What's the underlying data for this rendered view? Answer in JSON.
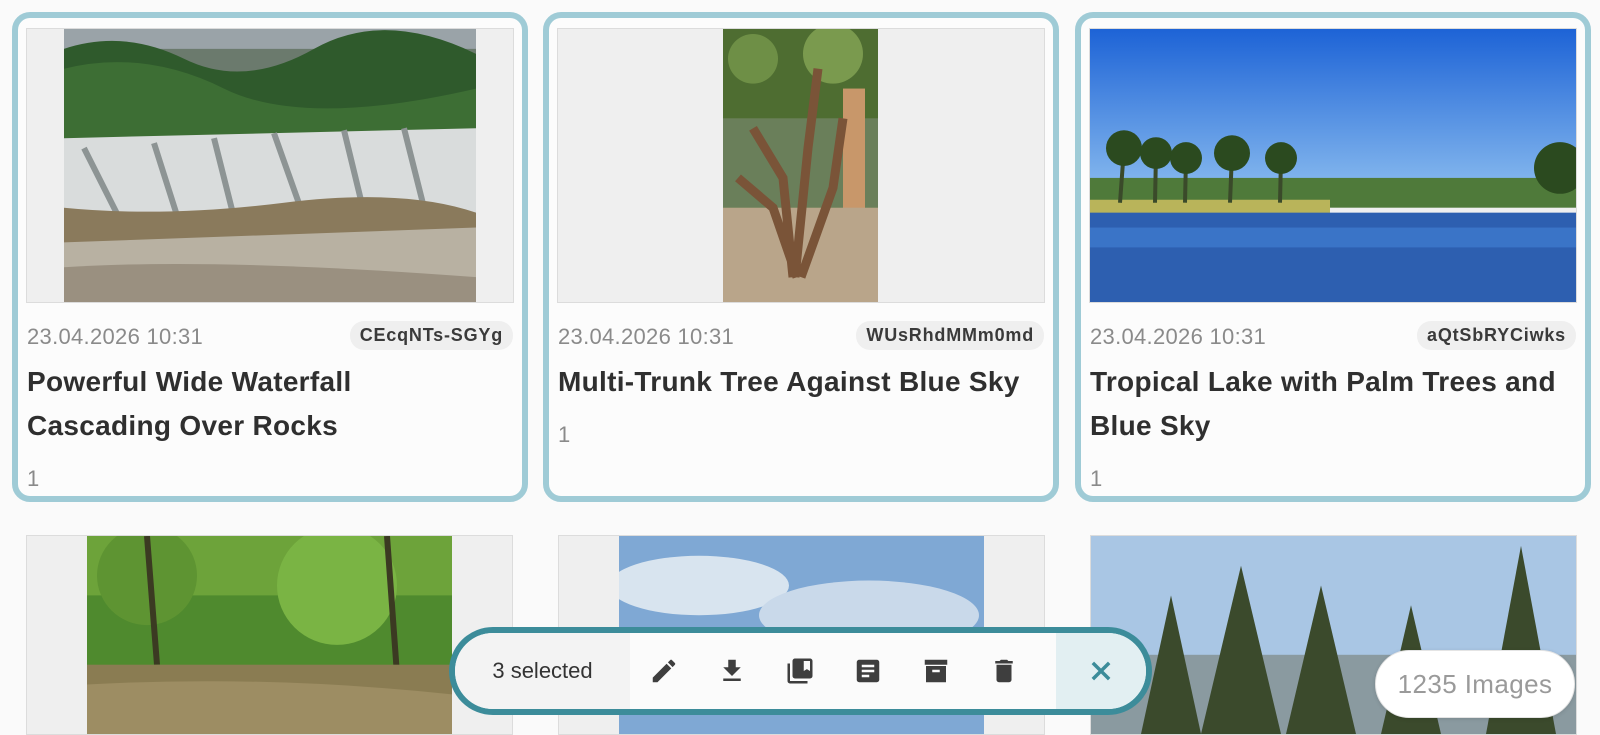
{
  "cards": [
    {
      "date": "23.04.2026 10:31",
      "uid": "CEcqNTs-SGYg",
      "title": "Powerful Wide Waterfall Cascading Over Rocks",
      "count": "1"
    },
    {
      "date": "23.04.2026 10:31",
      "uid": "WUsRhdMMm0md",
      "title": "Multi-Trunk Tree Against Blue Sky",
      "count": "1"
    },
    {
      "date": "23.04.2026 10:31",
      "uid": "aQtSbRYCiwks",
      "title": "Tropical Lake with Palm Trees and Blue Sky",
      "count": "1"
    }
  ],
  "toolbar": {
    "selected_label": "3 selected",
    "icons": [
      "edit-icon",
      "download-icon",
      "add-to-album-icon",
      "add-to-folder-icon",
      "archive-icon",
      "delete-icon",
      "close-icon"
    ]
  },
  "footer": {
    "image_count": "1235 Images"
  },
  "colors": {
    "selection_border": "#9fcbd6",
    "toolbar_border": "#3c8c9a",
    "background": "#fafafa"
  }
}
